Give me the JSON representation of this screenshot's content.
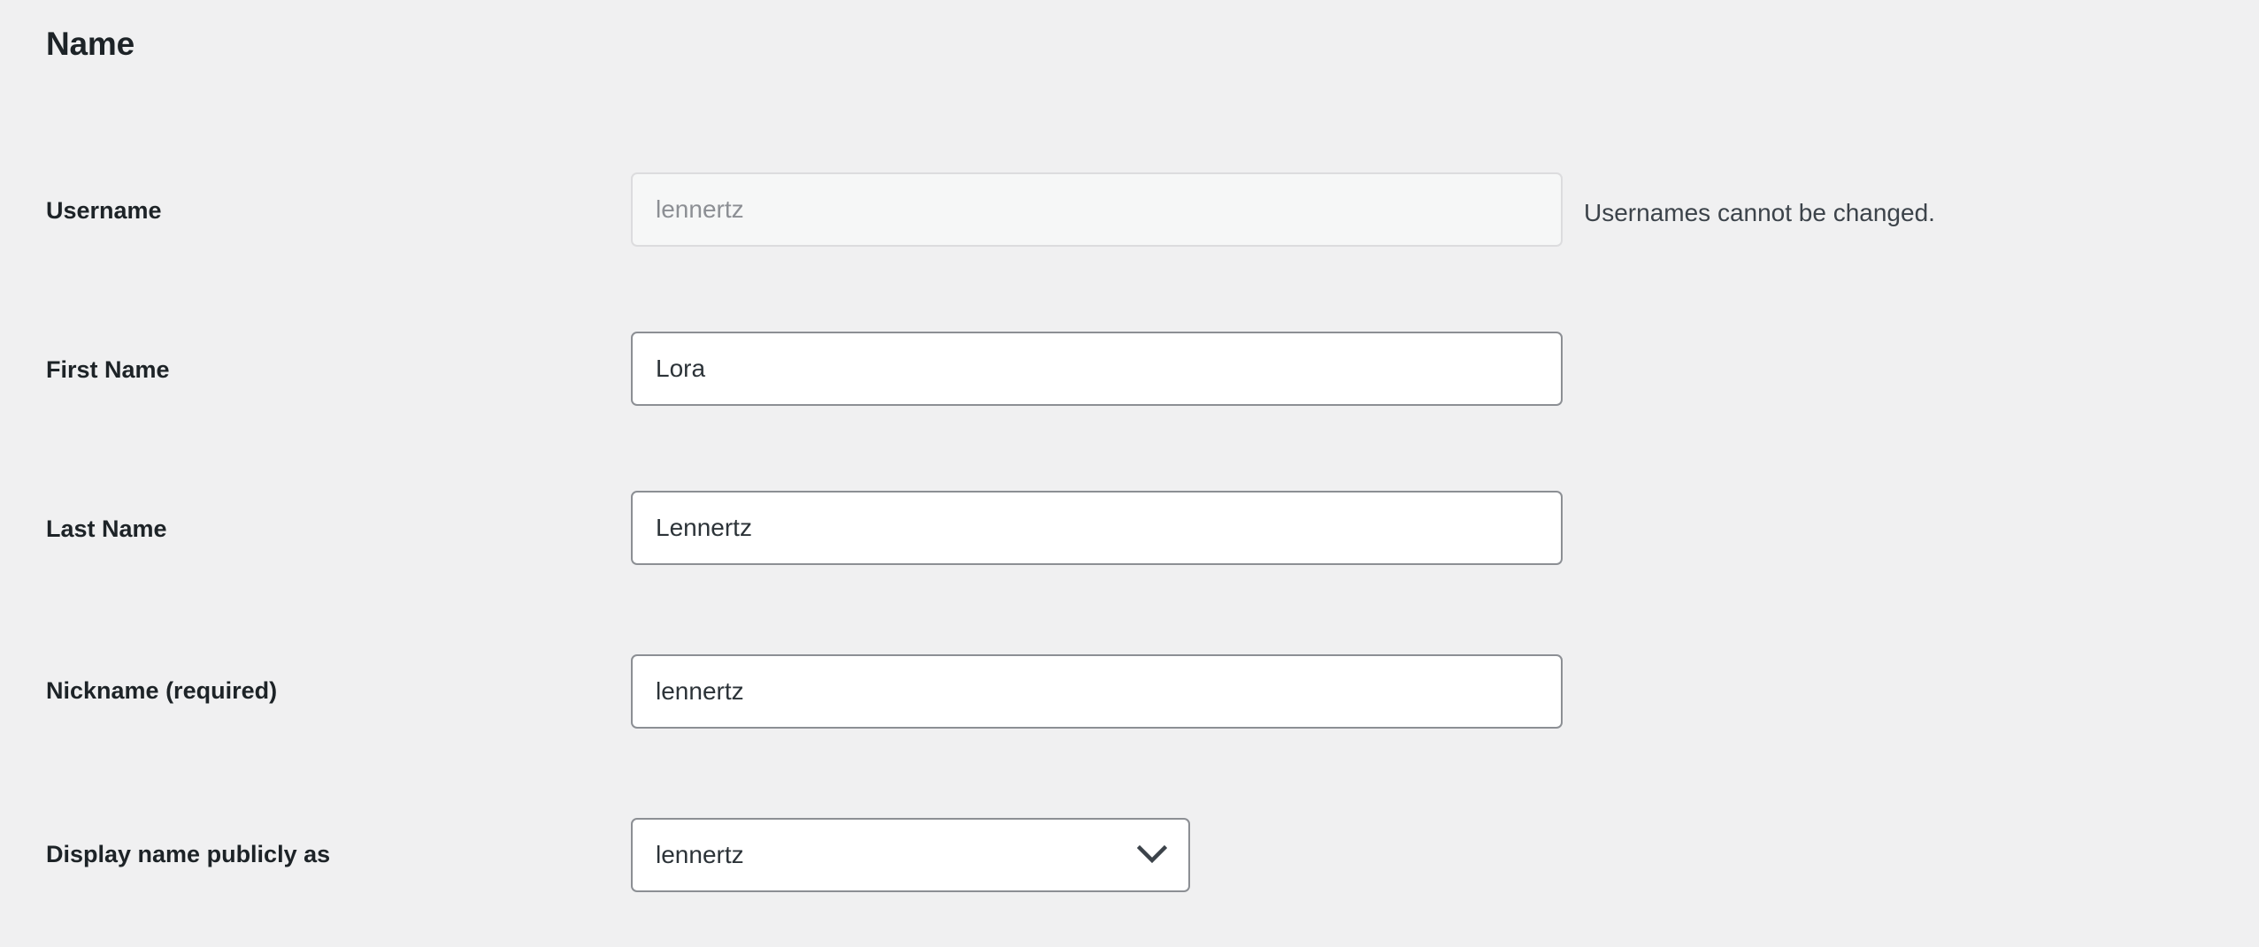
{
  "section": {
    "heading": "Name"
  },
  "fields": [
    {
      "label": "Username",
      "value": "lennertz",
      "placeholder": "",
      "help": "Usernames cannot be changed.",
      "type": "text",
      "disabled": true
    },
    {
      "label": "First Name",
      "value": "Lora",
      "placeholder": "",
      "help": "",
      "type": "text",
      "disabled": false
    },
    {
      "label": "Last Name",
      "value": "Lennertz",
      "placeholder": "",
      "help": "",
      "type": "text",
      "disabled": false
    },
    {
      "label": "Nickname (required)",
      "value": "lennertz",
      "placeholder": "",
      "help": "",
      "type": "text",
      "disabled": false
    },
    {
      "label": "Display name publicly as",
      "value": "lennertz",
      "placeholder": "",
      "help": "",
      "type": "select",
      "disabled": false,
      "icon": "chevron-down-icon"
    }
  ],
  "colors": {
    "background": "#f0f0f1",
    "label_text": "#1d2327",
    "input_text": "#2c3338",
    "input_border": "#8c8f94",
    "disabled_background": "#f6f7f7",
    "disabled_border": "#dcdcde",
    "disabled_text": "#8c8f94",
    "help_text": "#3c434a"
  }
}
